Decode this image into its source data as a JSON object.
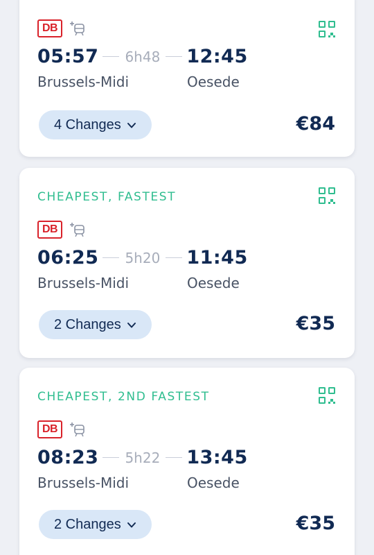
{
  "journeys": [
    {
      "badge": "",
      "carrier": "DB",
      "departure_time": "05:57",
      "duration": "6h48",
      "arrival_time": "12:45",
      "origin": "Brussels-Midi",
      "destination": "Oesede",
      "changes_label": "4 Changes",
      "price": "€84"
    },
    {
      "badge": "CHEAPEST, FASTEST",
      "carrier": "DB",
      "departure_time": "06:25",
      "duration": "5h20",
      "arrival_time": "11:45",
      "origin": "Brussels-Midi",
      "destination": "Oesede",
      "changes_label": "2 Changes",
      "price": "€35"
    },
    {
      "badge": "CHEAPEST, 2ND FASTEST",
      "carrier": "DB",
      "departure_time": "08:23",
      "duration": "5h22",
      "arrival_time": "13:45",
      "origin": "Brussels-Midi",
      "destination": "Oesede",
      "changes_label": "2 Changes",
      "price": "€35"
    }
  ],
  "icons": {
    "ticket": "qr-code-icon",
    "extra": "train-plus-icon",
    "changes_toggle": "chevron-down-icon"
  },
  "colors": {
    "accent_green": "#2fbd8f",
    "navy_text": "#112a53",
    "db_red": "#d9222a",
    "changes_pill_bg": "#d9e7f7"
  }
}
